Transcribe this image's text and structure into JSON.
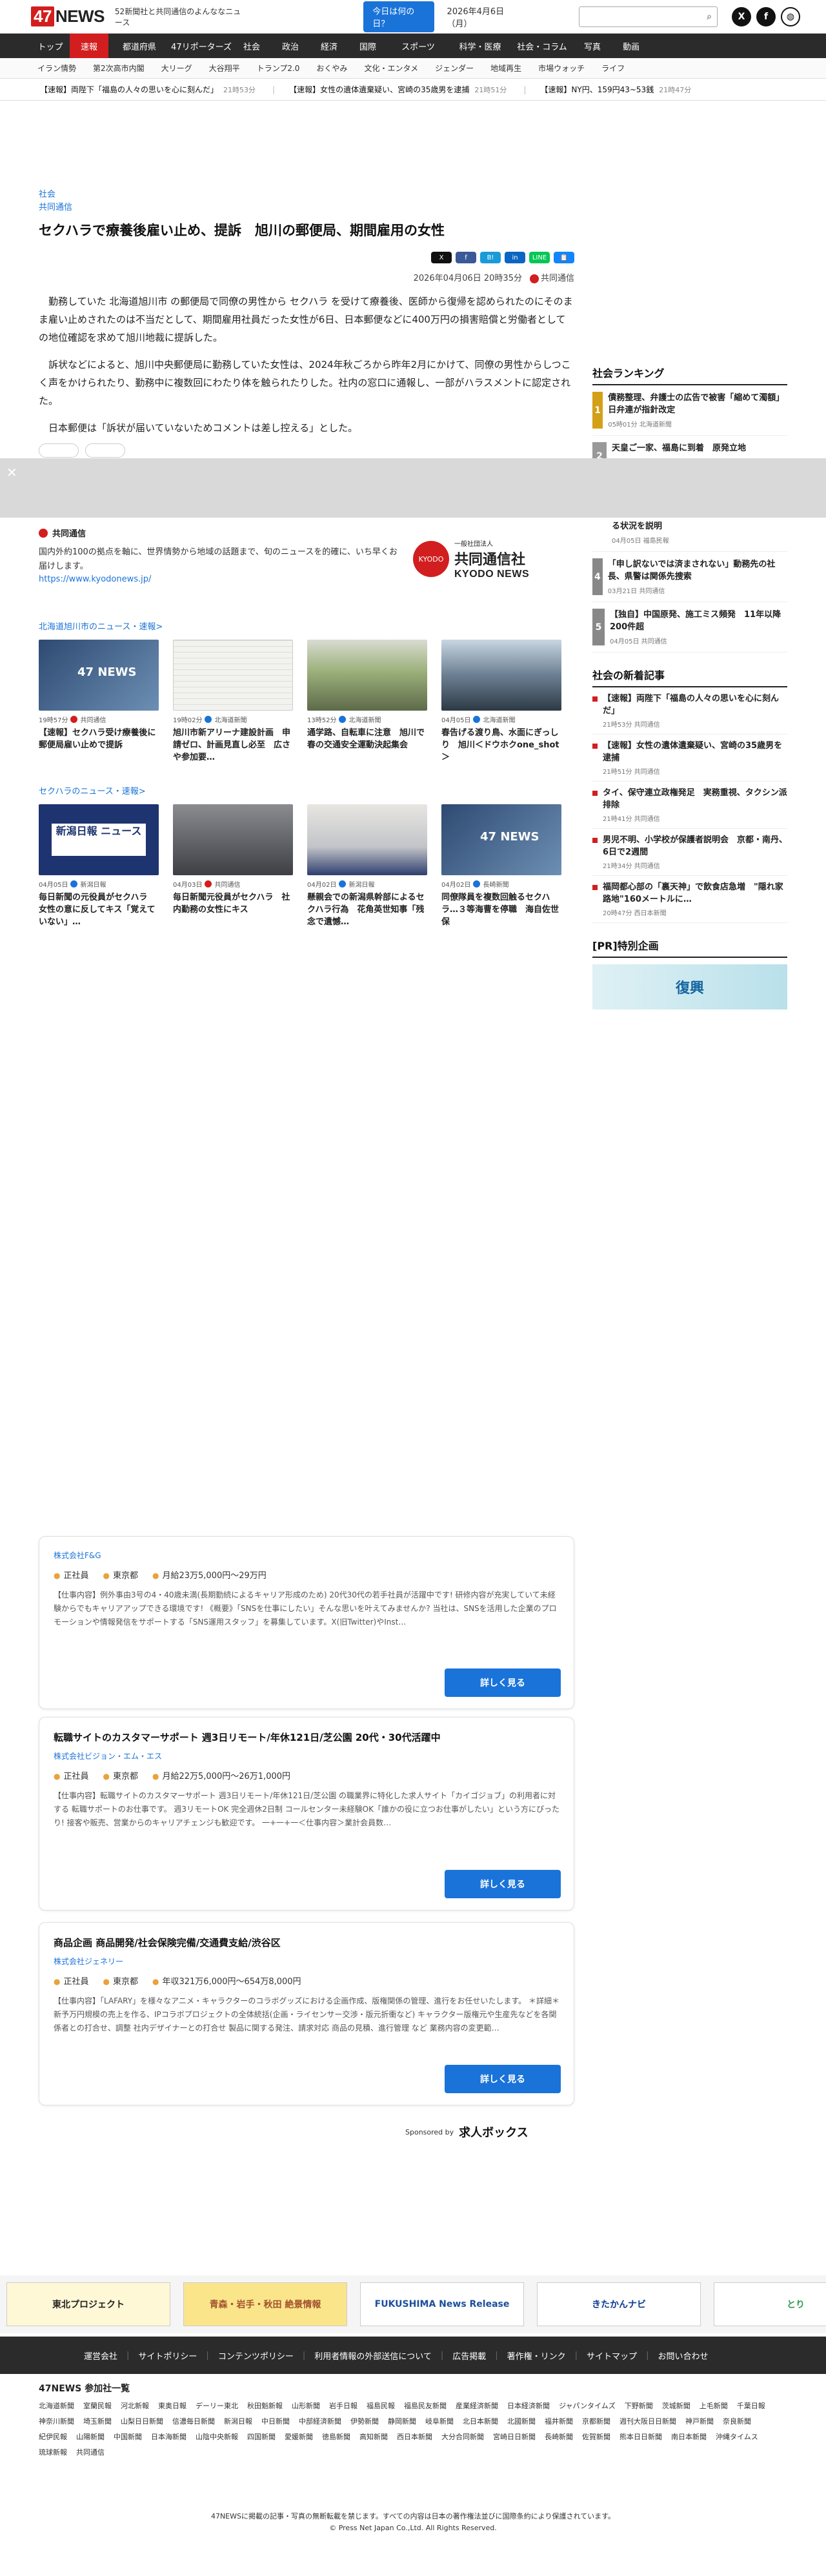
{
  "header": {
    "logo": "47NEWS",
    "tagline": "52新聞社と共同通信のよんななニュース",
    "today_button": "今日は何の日？",
    "date": "2026年4月6日（月）"
  },
  "nav": {
    "main": [
      "トップ",
      "速報",
      "都道府県",
      "47リポーターズ",
      "社会",
      "政治",
      "経済",
      "国際",
      "スポーツ",
      "科学・医療",
      "社会・コラム",
      "写真",
      "動画"
    ],
    "sub": [
      "イラン情勢",
      "第2次高市内閣",
      "大リーグ",
      "大谷翔平",
      "トランプ2.0",
      "おくやみ",
      "文化・エンタメ",
      "ジェンダー",
      "地域再生",
      "市場ウォッチ",
      "ライフ"
    ]
  },
  "ticker": [
    {
      "text": "【速報】両陛下「福島の人々の思いを心に刻んだ」",
      "time": "21時53分"
    },
    {
      "text": "【速報】女性の遺体遺棄疑い、宮崎の35歳男を逮捕",
      "time": "21時51分"
    },
    {
      "text": "【速報】NY円、159円43~53銭",
      "time": "21時47分"
    }
  ],
  "article": {
    "category1": "社会",
    "category2": "共同通信",
    "title": "セクハラで療養後雇い止め、提訴　旭川の郵便局、期間雇用の女性",
    "datetime": "2026年04月06日  20時35分",
    "source": "共同通信",
    "p1": "勤務していた 北海道旭川市 の郵便局で同僚の男性から セクハラ を受けて療養後、医師から復帰を認められたのにそのまま雇い止めされたのは不当だとして、期間雇用社員だった女性が6日、日本郵便などに400万円の損害賠償と労働者としての地位確認を求めて旭川地裁に提訴した。",
    "p2": "訴状などによると、旭川中央郵便局に勤務していた女性は、2024年秋ごろから昨年2月にかけて、同僚の男性からしつこく声をかけられたり、勤務中に複数回にわたり体を触られたりした。社内の窓口に通報し、一部がハラスメントに認定された。",
    "p3": "日本郵便は「訴状が届いていないためコメントは差し控える」とした。"
  },
  "share": [
    "X",
    "f",
    "B!",
    "in",
    "LINE",
    "📋"
  ],
  "source_box": {
    "name": "共同通信",
    "desc": "国内外約100の拠点を軸に、世界情勢から地域の話題まで、旬のニュースを的確に、いち早くお届けします。",
    "url": "https://www.kyodonews.jp/",
    "logo_jp": "共同通信社",
    "logo_en": "KYODO NEWS",
    "logo_small": "一般社団法人"
  },
  "sec1": {
    "link": "北海道旭川市のニュース・速報>",
    "cards": [
      {
        "meta": "19時57分",
        "src": "共同通信",
        "title": "【速報】セクハラ受け療養後に郵便局雇い止めで提訴"
      },
      {
        "meta": "19時02分",
        "src": "北海道新聞",
        "title": "旭川市新アリーナ建設計画　申請ゼロ、計画見直し必至　広さや参加要…"
      },
      {
        "meta": "13時52分",
        "src": "北海道新聞",
        "title": "通学路、自転車に注意　旭川で春の交通安全運動決起集会"
      },
      {
        "meta": "04月05日",
        "src": "北海道新聞",
        "title": "春告げる渡り鳥、水面にぎっしり　旭川＜ドウホクone_shot＞"
      }
    ]
  },
  "sec2": {
    "link": "セクハラのニュース・速報>",
    "cards": [
      {
        "meta": "04月05日",
        "src": "新潟日報",
        "title": "毎日新聞の元役員がセクハラ　女性の意に反してキス「覚えていない」…",
        "thumb": "新潟日報 ニュース"
      },
      {
        "meta": "04月03日",
        "src": "共同通信",
        "title": "毎日新聞元役員がセクハラ　社内勤務の女性にキス"
      },
      {
        "meta": "04月02日",
        "src": "新潟日報",
        "title": "懸親会での新潟県幹部によるセクハラ行為　花角英世知事「残念で遺憾…"
      },
      {
        "meta": "04月02日",
        "src": "長崎新聞",
        "title": "同僚隊員を複数回触るセクハラ…３等海曹を停職　海自佐世保"
      }
    ]
  },
  "sidebar": {
    "ranking_title": "社会ランキング",
    "ranking": [
      {
        "title": "債務整理、弁護士の広告で被害「縮めて濁額」日弁連が指針改定",
        "meta": "05時01分",
        "src": "北海道新聞"
      },
      {
        "title": "天皇ご一家、福島に到着　原発立地",
        "meta": "",
        "src": ""
      },
      {
        "title": "る状況を説明",
        "meta": "04月05日",
        "src": "福島民報"
      },
      {
        "title": "「申し訳ないでは済まされない」動務先の社長、県警は関係先捜索",
        "meta": "03月21日",
        "src": "共同通信"
      },
      {
        "title": "【独自】中国原発、施工ミス頻発　11年以降200件超",
        "meta": "04月05日",
        "src": "共同通信"
      }
    ],
    "newest_title": "社会の新着記事",
    "newest": [
      {
        "title": "【速報】両陛下「福島の人々の思いを心に刻んだ」",
        "meta": "21時53分",
        "src": "共同通信"
      },
      {
        "title": "【速報】女性の遺体遺棄疑い、宮崎の35歳男を逮捕",
        "meta": "21時51分",
        "src": "共同通信"
      },
      {
        "title": "タイ、保守連立政権発足　実務重視、タクシン派排除",
        "meta": "21時41分",
        "src": "共同通信"
      },
      {
        "title": "男児不明、小学校が保護者説明会　京都・南丹、6日で2週間",
        "meta": "21時34分",
        "src": "共同通信"
      },
      {
        "title": "福岡都心部の「裏天神」で飲食店急増　\"隠れ家路地\"160メートルに…",
        "meta": "20時47分",
        "src": "西日本新聞"
      }
    ],
    "pr_title": "[PR]特別企画",
    "pr_banner": "復興"
  },
  "jobs": [
    {
      "title": "",
      "company": "株式会社F&G",
      "type": "正社員",
      "place": "東京都",
      "salary": "月給23万5,000円〜29万円",
      "desc": "【仕事内容】例外事由3号の4・40歳未満(長期勤続によるキャリア形成のため) 20代30代の若手社員が活躍中です! 研修内容が充実していて未経験からでもキャリアアップできる環境です! 《概要》「SNSを仕事にしたい」そんな思いを叶えてみませんか? 当社は、SNSを活用した企業のプロモーションや情報発信をサポートする「SNS運用スタッフ」を募集しています。X(旧Twitter)やInst…",
      "button": "詳しく見る"
    },
    {
      "title": "転職サイトのカスタマーサポート 週3日リモート/年休121日/芝公園 20代・30代活躍中",
      "company": "株式会社ビジョン・エム・エス",
      "type": "正社員",
      "place": "東京都",
      "salary": "月給22万5,000円〜26万1,000円",
      "desc": "【仕事内容】転職サイトのカスタマーサポート 週3日リモート/年休121日/芝公園 の職業界に特化した求人サイト「カイゴジョブ」の利用者に対する 転職サポートのお仕事です。 週3リモートOK 完全週休2日制 コールセンター未経験OK「誰かの役に立つお仕事がしたい」という方にぴったり! 接客や販売、営業からのキャリアチェンジも歓迎です。 一+一+一＜仕事内容＞業計会員数…",
      "button": "詳しく見る"
    },
    {
      "title": "商品企画 商品開発/社会保険完備/交通費支給/渋谷区",
      "company": "株式会社ジェネリー",
      "type": "正社員",
      "place": "東京都",
      "salary": "年収321万6,000円〜654万8,000円",
      "desc": "【仕事内容】「LAFARY」を様々なアニメ・キャラクターのコラボグッズにおける企画作成、版権関係の管理、進行をお任せいたします。 ＊詳細＊ 新予万円規模の売上を作る、IPコラボプロジェクトの全体統括(企画・ライセンサー交渉・版元折衝など) キャラクター版権元や生産先などを各関係者との打合せ、調整 社内デザイナーとの打合せ 製品に関する発注、請求対応 商品の見積、進行管理 など 業務内容の変更範…",
      "button": "詳しく見る"
    }
  ],
  "sponsor": {
    "label": "Sponsored by",
    "name": "求人ボックス"
  },
  "banners": [
    "東北プロジェクト",
    "青森・岩手・秋田 絶景情報",
    "FUKUSHIMA News Release",
    "きたかんナビ",
    "とり"
  ],
  "footer": {
    "links": [
      "運営会社",
      "サイトポリシー",
      "コンテンツポリシー",
      "利用者情報の外部送信について",
      "広告掲載",
      "著作権・リンク",
      "サイトマップ",
      "お問い合わせ"
    ],
    "partners_title": "47NEWS 参加社一覧",
    "partners": [
      "北海道新聞",
      "室蘭民報",
      "河北新報",
      "東奥日報",
      "デーリー東北",
      "秋田魁新報",
      "山形新聞",
      "岩手日報",
      "福島民報",
      "福島民友新聞",
      "産業経済新聞",
      "日本経済新聞",
      "ジャパンタイムズ",
      "下野新聞",
      "茨城新聞",
      "上毛新聞",
      "千葉日報",
      "神奈川新聞",
      "埼玉新聞",
      "山梨日日新聞",
      "信濃毎日新聞",
      "新潟日報",
      "中日新聞",
      "中部経済新聞",
      "伊勢新聞",
      "静岡新聞",
      "岐阜新聞",
      "北日本新聞",
      "北國新聞",
      "福井新聞",
      "京都新聞",
      "週刊大阪日日新聞",
      "神戸新聞",
      "奈良新聞",
      "紀伊民報",
      "山陽新聞",
      "中国新聞",
      "日本海新聞",
      "山陰中央新報",
      "四国新聞",
      "愛媛新聞",
      "徳島新聞",
      "高知新聞",
      "西日本新聞",
      "大分合同新聞",
      "宮崎日日新聞",
      "長崎新聞",
      "佐賀新聞",
      "熊本日日新聞",
      "南日本新聞",
      "沖縄タイムス",
      "琉球新報",
      "共同通信"
    ],
    "copy1": "47NEWSに掲載の記事・写真の無断転載を禁じます。すべての内容は日本の著作権法並びに国際条約により保護されています。",
    "copy2": "© Press Net Japan Co.,Ltd. All Rights Reserved."
  }
}
